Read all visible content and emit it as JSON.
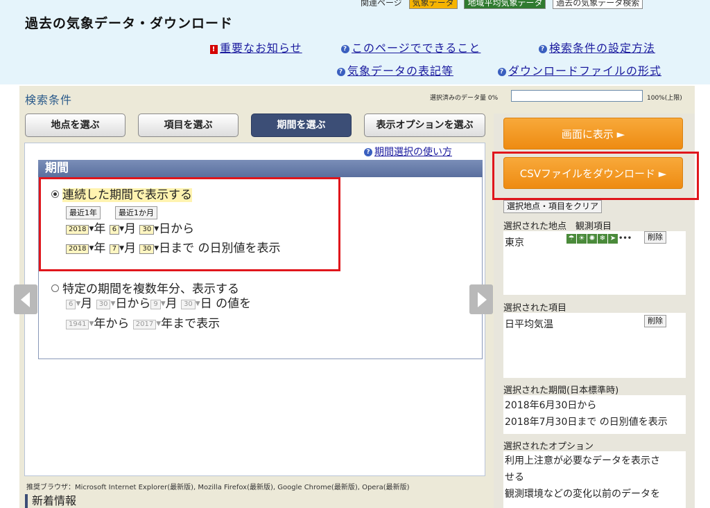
{
  "header": {
    "top_links": {
      "label": "関連ページ",
      "links": [
        "気象データ",
        "地域平均気象データ",
        "過去の気象データ検索"
      ]
    },
    "title": "過去の気象データ・ダウンロード",
    "links": {
      "important": "重要なお知らせ",
      "about": "このページでできること",
      "settings": "検索条件の設定方法",
      "notation": "気象データの表記等",
      "format": "ダウンロードファイルの形式"
    }
  },
  "search": {
    "title": "検索条件",
    "data_amount": {
      "label": "選択済みのデータ量 0%",
      "max_label": "100%(上限)",
      "percent": 0
    },
    "tabs": [
      {
        "label": "地点を選ぶ",
        "active": false
      },
      {
        "label": "項目を選ぶ",
        "active": false
      },
      {
        "label": "期間を選ぶ",
        "active": true
      },
      {
        "label": "表示オプションを選ぶ",
        "active": false
      }
    ],
    "help_link": "期間選択の使い方"
  },
  "period": {
    "header": "期間",
    "continuous": {
      "label": "連続した期間で表示する",
      "selected": true,
      "quick_last_year": "最近1年",
      "quick_last_month": "最近1か月",
      "start": {
        "year": "2018",
        "month": "6",
        "day": "30"
      },
      "end": {
        "year": "2018",
        "month": "7",
        "day": "30"
      },
      "year_unit": "年",
      "month_unit": "月",
      "from_text": "日から",
      "until_text": "日まで の日別値を表示"
    },
    "multi_year": {
      "label": "特定の期間を複数年分、表示する",
      "selected": false,
      "start_month": "6",
      "start_day": "30",
      "end_month": "9",
      "end_day": "30",
      "from_year": "1941",
      "to_year": "2017",
      "month_unit": "月",
      "from_text": "日から",
      "day_values_text": "日 の値を",
      "year_from_text": "年から",
      "year_to_text": "年まで表示"
    }
  },
  "footer": {
    "browser": "推奨ブラウザ：Microsoft Internet Explorer(最新版), Mozilla Firefox(最新版), Google Chrome(最新版), Opera(最新版)",
    "news_title": "新着情報"
  },
  "sidebar": {
    "show_button": "画面に表示 ►",
    "csv_button": "CSVファイルをダウンロード ►",
    "clear_button": "選択地点・項目をクリア",
    "stations_label": "選択された地点　観測項目",
    "station_name": "東京",
    "station_icons": [
      "rain-icon",
      "sun-icon",
      "sunshine-icon",
      "snow-icon",
      "wind-icon"
    ],
    "delete_label": "削除",
    "items_label": "選択された項目",
    "item_name": "日平均気温",
    "period_label": "選択された期間(日本標準時)",
    "period_line1": "2018年6月30日から",
    "period_line2": "2018年7月30日まで の日別値を表示",
    "options_label": "選択されたオプション",
    "option_line1": "利用上注意が必要なデータを表示さ",
    "option_line2": "せる",
    "option_line3": "観測環境などの変化以前のデータを"
  }
}
